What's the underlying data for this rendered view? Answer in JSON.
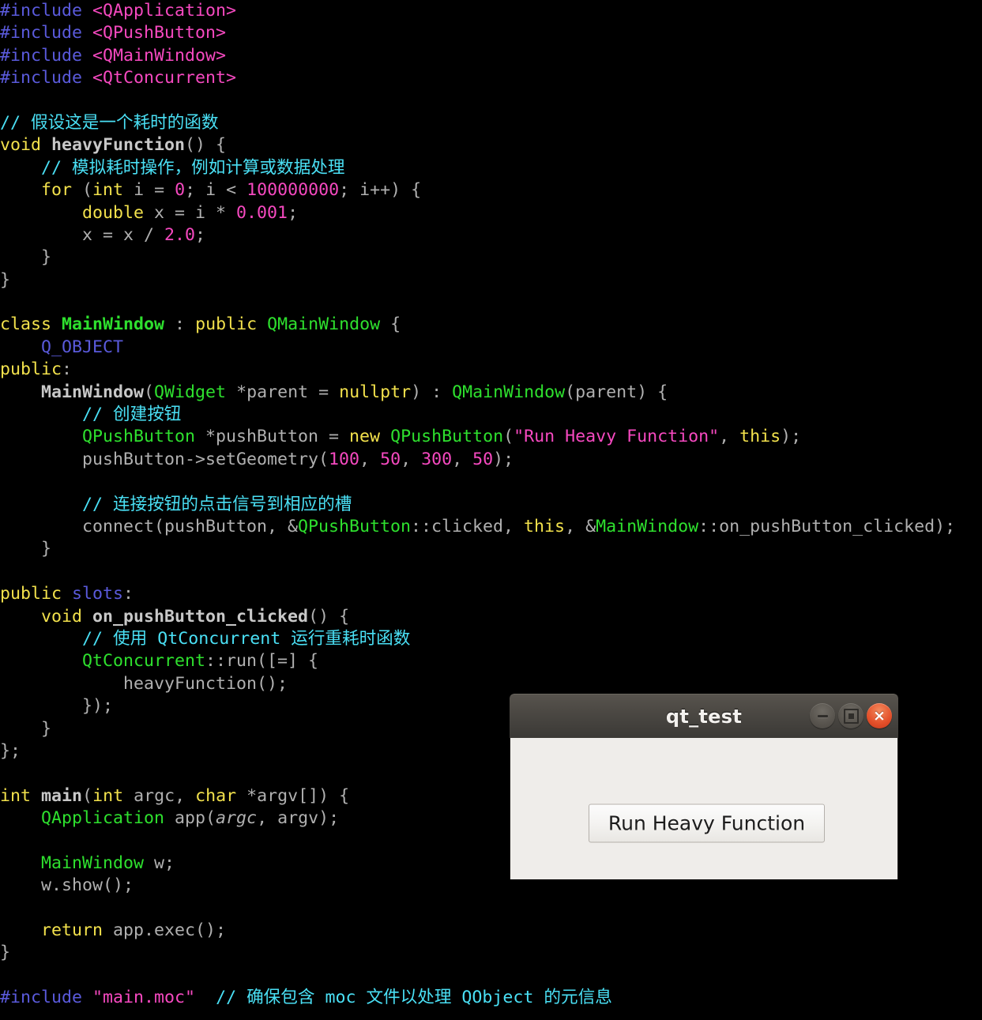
{
  "editor": {
    "background": "#000000",
    "default_text_color": "#b0b0b0",
    "language": "C++",
    "lines": [
      {
        "n": 1,
        "segments": [
          {
            "c": "t-pre",
            "t": "#include"
          },
          {
            "c": "t-plain",
            "t": " "
          },
          {
            "c": "t-hdr",
            "t": "<QApplication>"
          }
        ]
      },
      {
        "n": 2,
        "segments": [
          {
            "c": "t-pre",
            "t": "#include"
          },
          {
            "c": "t-plain",
            "t": " "
          },
          {
            "c": "t-hdr",
            "t": "<QPushButton>"
          }
        ]
      },
      {
        "n": 3,
        "segments": [
          {
            "c": "t-pre",
            "t": "#include"
          },
          {
            "c": "t-plain",
            "t": " "
          },
          {
            "c": "t-hdr",
            "t": "<QMainWindow>"
          }
        ]
      },
      {
        "n": 4,
        "segments": [
          {
            "c": "t-pre",
            "t": "#include"
          },
          {
            "c": "t-plain",
            "t": " "
          },
          {
            "c": "t-hdr",
            "t": "<QtConcurrent>"
          }
        ]
      },
      {
        "n": 5,
        "segments": []
      },
      {
        "n": 6,
        "segments": [
          {
            "c": "t-cmt",
            "t": "// 假设这是一个耗时的函数"
          }
        ]
      },
      {
        "n": 7,
        "segments": [
          {
            "c": "t-kw",
            "t": "void"
          },
          {
            "c": "t-plain",
            "t": " "
          },
          {
            "c": "t-fnbold",
            "t": "heavyFunction"
          },
          {
            "c": "t-plain",
            "t": "() {"
          }
        ]
      },
      {
        "n": 8,
        "segments": [
          {
            "c": "t-cmt",
            "t": "    // 模拟耗时操作，例如计算或数据处理"
          }
        ]
      },
      {
        "n": 9,
        "segments": [
          {
            "c": "t-plain",
            "t": "    "
          },
          {
            "c": "t-kw",
            "t": "for"
          },
          {
            "c": "t-plain",
            "t": " ("
          },
          {
            "c": "t-kw",
            "t": "int"
          },
          {
            "c": "t-plain",
            "t": " i = "
          },
          {
            "c": "t-num",
            "t": "0"
          },
          {
            "c": "t-plain",
            "t": "; i < "
          },
          {
            "c": "t-num",
            "t": "100000000"
          },
          {
            "c": "t-plain",
            "t": "; i++) {"
          }
        ]
      },
      {
        "n": 10,
        "segments": [
          {
            "c": "t-plain",
            "t": "        "
          },
          {
            "c": "t-kw",
            "t": "double"
          },
          {
            "c": "t-plain",
            "t": " x = i * "
          },
          {
            "c": "t-num",
            "t": "0.001"
          },
          {
            "c": "t-plain",
            "t": ";"
          }
        ]
      },
      {
        "n": 11,
        "segments": [
          {
            "c": "t-plain",
            "t": "        x = x / "
          },
          {
            "c": "t-num",
            "t": "2.0"
          },
          {
            "c": "t-plain",
            "t": ";"
          }
        ]
      },
      {
        "n": 12,
        "segments": [
          {
            "c": "t-plain",
            "t": "    }"
          }
        ]
      },
      {
        "n": 13,
        "segments": [
          {
            "c": "t-plain",
            "t": "}"
          }
        ]
      },
      {
        "n": 14,
        "segments": []
      },
      {
        "n": 15,
        "segments": [
          {
            "c": "t-kw",
            "t": "class"
          },
          {
            "c": "t-plain",
            "t": " "
          },
          {
            "c": "t-clsbold",
            "t": "MainWindow"
          },
          {
            "c": "t-plain",
            "t": " : "
          },
          {
            "c": "t-kw",
            "t": "public"
          },
          {
            "c": "t-plain",
            "t": " "
          },
          {
            "c": "t-type",
            "t": "QMainWindow"
          },
          {
            "c": "t-plain",
            "t": " {"
          }
        ]
      },
      {
        "n": 16,
        "segments": [
          {
            "c": "t-plain",
            "t": "    "
          },
          {
            "c": "t-macro",
            "t": "Q_OBJECT"
          }
        ]
      },
      {
        "n": 17,
        "segments": [
          {
            "c": "t-kw",
            "t": "public"
          },
          {
            "c": "t-plain",
            "t": ":"
          }
        ]
      },
      {
        "n": 18,
        "segments": [
          {
            "c": "t-plain",
            "t": "    "
          },
          {
            "c": "t-fnbold",
            "t": "MainWindow"
          },
          {
            "c": "t-plain",
            "t": "("
          },
          {
            "c": "t-type",
            "t": "QWidget"
          },
          {
            "c": "t-plain",
            "t": " *parent = "
          },
          {
            "c": "t-kw",
            "t": "nullptr"
          },
          {
            "c": "t-plain",
            "t": ") : "
          },
          {
            "c": "t-type",
            "t": "QMainWindow"
          },
          {
            "c": "t-plain",
            "t": "(parent) {"
          }
        ]
      },
      {
        "n": 19,
        "segments": [
          {
            "c": "t-cmt",
            "t": "        // 创建按钮"
          }
        ]
      },
      {
        "n": 20,
        "segments": [
          {
            "c": "t-plain",
            "t": "        "
          },
          {
            "c": "t-type",
            "t": "QPushButton"
          },
          {
            "c": "t-plain",
            "t": " *pushButton = "
          },
          {
            "c": "t-kw",
            "t": "new"
          },
          {
            "c": "t-plain",
            "t": " "
          },
          {
            "c": "t-type",
            "t": "QPushButton"
          },
          {
            "c": "t-plain",
            "t": "("
          },
          {
            "c": "t-str",
            "t": "\"Run Heavy Function\""
          },
          {
            "c": "t-plain",
            "t": ", "
          },
          {
            "c": "t-kw",
            "t": "this"
          },
          {
            "c": "t-plain",
            "t": ");"
          }
        ]
      },
      {
        "n": 21,
        "segments": [
          {
            "c": "t-plain",
            "t": "        pushButton->setGeometry("
          },
          {
            "c": "t-num",
            "t": "100"
          },
          {
            "c": "t-plain",
            "t": ", "
          },
          {
            "c": "t-num",
            "t": "50"
          },
          {
            "c": "t-plain",
            "t": ", "
          },
          {
            "c": "t-num",
            "t": "300"
          },
          {
            "c": "t-plain",
            "t": ", "
          },
          {
            "c": "t-num",
            "t": "50"
          },
          {
            "c": "t-plain",
            "t": ");"
          }
        ]
      },
      {
        "n": 22,
        "segments": []
      },
      {
        "n": 23,
        "segments": [
          {
            "c": "t-cmt",
            "t": "        // 连接按钮的点击信号到相应的槽"
          }
        ]
      },
      {
        "n": 24,
        "segments": [
          {
            "c": "t-plain",
            "t": "        connect(pushButton, &"
          },
          {
            "c": "t-type",
            "t": "QPushButton"
          },
          {
            "c": "t-plain",
            "t": "::clicked, "
          },
          {
            "c": "t-kw",
            "t": "this"
          },
          {
            "c": "t-plain",
            "t": ", &"
          },
          {
            "c": "t-type",
            "t": "MainWindow"
          },
          {
            "c": "t-plain",
            "t": "::on_pushButton_clicked);"
          }
        ]
      },
      {
        "n": 25,
        "segments": [
          {
            "c": "t-plain",
            "t": "    }"
          }
        ]
      },
      {
        "n": 26,
        "segments": []
      },
      {
        "n": 27,
        "segments": [
          {
            "c": "t-kw",
            "t": "public"
          },
          {
            "c": "t-plain",
            "t": " "
          },
          {
            "c": "t-macro",
            "t": "slots"
          },
          {
            "c": "t-plain",
            "t": ":"
          }
        ]
      },
      {
        "n": 28,
        "segments": [
          {
            "c": "t-plain",
            "t": "    "
          },
          {
            "c": "t-kw",
            "t": "void"
          },
          {
            "c": "t-plain",
            "t": " "
          },
          {
            "c": "t-fnbold",
            "t": "on_pushButton_clicked"
          },
          {
            "c": "t-plain",
            "t": "() {"
          }
        ]
      },
      {
        "n": 29,
        "segments": [
          {
            "c": "t-cmt",
            "t": "        // 使用 QtConcurrent 运行重耗时函数"
          }
        ]
      },
      {
        "n": 30,
        "segments": [
          {
            "c": "t-plain",
            "t": "        "
          },
          {
            "c": "t-type",
            "t": "QtConcurrent"
          },
          {
            "c": "t-plain",
            "t": "::run([=] {"
          }
        ]
      },
      {
        "n": 31,
        "segments": [
          {
            "c": "t-plain",
            "t": "            heavyFunction();"
          }
        ]
      },
      {
        "n": 32,
        "segments": [
          {
            "c": "t-plain",
            "t": "        });"
          }
        ]
      },
      {
        "n": 33,
        "segments": [
          {
            "c": "t-plain",
            "t": "    }"
          }
        ]
      },
      {
        "n": 34,
        "segments": [
          {
            "c": "t-plain",
            "t": "};"
          }
        ]
      },
      {
        "n": 35,
        "segments": []
      },
      {
        "n": 36,
        "segments": [
          {
            "c": "t-kw",
            "t": "int"
          },
          {
            "c": "t-plain",
            "t": " "
          },
          {
            "c": "t-fnbold",
            "t": "main"
          },
          {
            "c": "t-plain",
            "t": "("
          },
          {
            "c": "t-kw",
            "t": "int"
          },
          {
            "c": "t-plain",
            "t": " argc, "
          },
          {
            "c": "t-kw",
            "t": "char"
          },
          {
            "c": "t-plain",
            "t": " *argv[]) {"
          }
        ]
      },
      {
        "n": 37,
        "segments": [
          {
            "c": "t-plain",
            "t": "    "
          },
          {
            "c": "t-type",
            "t": "QApplication"
          },
          {
            "c": "t-plain",
            "t": " app("
          },
          {
            "c": "t-italic",
            "t": "argc"
          },
          {
            "c": "t-plain",
            "t": ", argv);"
          }
        ]
      },
      {
        "n": 38,
        "segments": []
      },
      {
        "n": 39,
        "segments": [
          {
            "c": "t-plain",
            "t": "    "
          },
          {
            "c": "t-type",
            "t": "MainWindow"
          },
          {
            "c": "t-plain",
            "t": " w;"
          }
        ]
      },
      {
        "n": 40,
        "segments": [
          {
            "c": "t-plain",
            "t": "    w.show();"
          }
        ]
      },
      {
        "n": 41,
        "segments": []
      },
      {
        "n": 42,
        "segments": [
          {
            "c": "t-plain",
            "t": "    "
          },
          {
            "c": "t-kw",
            "t": "return"
          },
          {
            "c": "t-plain",
            "t": " app.exec();"
          }
        ]
      },
      {
        "n": 43,
        "segments": [
          {
            "c": "t-plain",
            "t": "}"
          }
        ]
      },
      {
        "n": 44,
        "segments": []
      },
      {
        "n": 45,
        "segments": [
          {
            "c": "t-pre",
            "t": "#include"
          },
          {
            "c": "t-plain",
            "t": " "
          },
          {
            "c": "t-str",
            "t": "\"main.moc\""
          },
          {
            "c": "t-plain",
            "t": "  "
          },
          {
            "c": "t-cmt",
            "t": "// 确保包含 moc 文件以处理 QObject 的元信息"
          }
        ]
      }
    ]
  },
  "qt_window": {
    "title": "qt_test",
    "titlebar_color": "#4a4742",
    "client_color": "#efedea",
    "controls": {
      "minimize_label": "minimize",
      "maximize_label": "maximize",
      "close_label": "close",
      "close_glyph": "×",
      "close_color": "#e4502a"
    },
    "button": {
      "label": "Run Heavy Function"
    }
  }
}
